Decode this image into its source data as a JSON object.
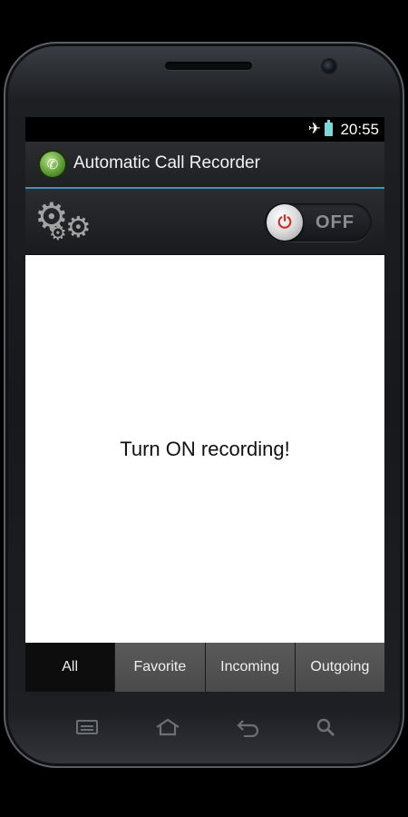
{
  "status_bar": {
    "time": "20:55",
    "icons": [
      "airplane-mode-icon",
      "battery-icon"
    ]
  },
  "app": {
    "title": "Automatic Call Recorder",
    "icon": "phone-icon"
  },
  "toolbar": {
    "settings_icon": "gears-icon",
    "toggle": {
      "state": "OFF",
      "label": "OFF",
      "icon": "power-icon"
    }
  },
  "content": {
    "message": "Turn ON recording!"
  },
  "tabs": [
    {
      "label": "All",
      "active": true
    },
    {
      "label": "Favorite",
      "active": false
    },
    {
      "label": "Incoming",
      "active": false
    },
    {
      "label": "Outgoing",
      "active": false
    }
  ],
  "hardware_keys": [
    "menu-icon",
    "home-icon",
    "back-icon",
    "search-icon"
  ],
  "colors": {
    "accent": "#4a8db5",
    "app_icon": "#5f9e36",
    "power": "#c8332f",
    "battery": "#7ed7d4"
  }
}
